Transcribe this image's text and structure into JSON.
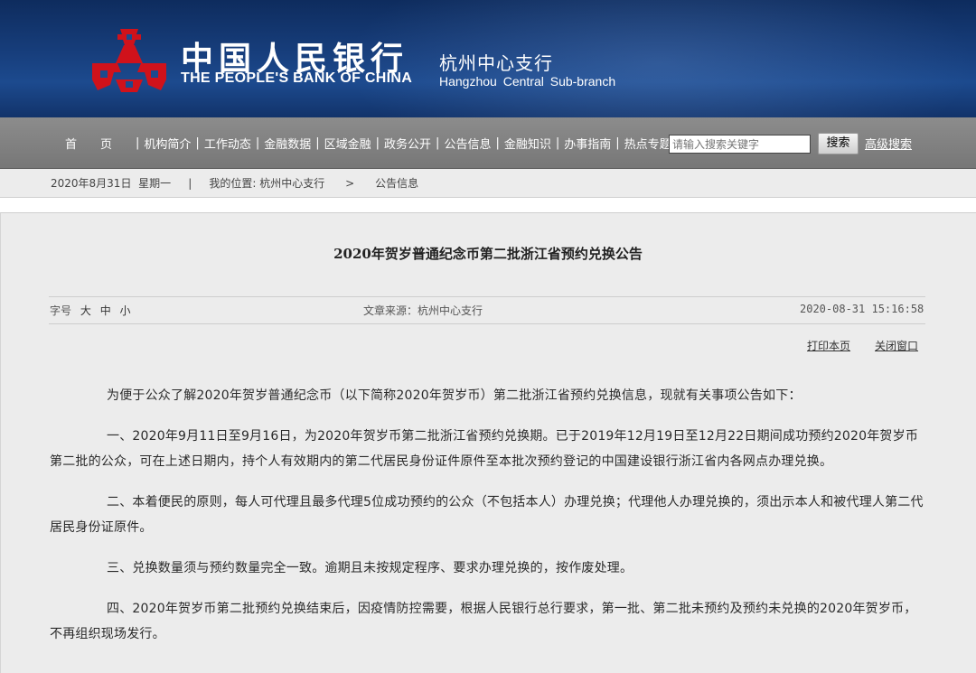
{
  "header": {
    "bank_name_cn": "中国人民银行",
    "bank_name_en": "THE PEOPLE'S BANK OF CHINA",
    "branch_cn": "杭州中心支行",
    "branch_en": "Hangzhou Central Sub-branch",
    "logo_icon": "pboc-emblem-icon",
    "colors": {
      "banner": "#173e7c",
      "emblem": "#d0121b"
    }
  },
  "nav": {
    "items": [
      "首页",
      "机构简介",
      "工作动态",
      "金融数据",
      "区域金融",
      "政务公开",
      "公告信息",
      "金融知识",
      "办事指南",
      "热点专题"
    ],
    "separator": "|",
    "search_placeholder": "请输入搜索关键字",
    "search_button": "搜索",
    "advanced_search": "高级搜索"
  },
  "breadcrumb": {
    "date": "2020年8月31日  星期一",
    "sep": "|",
    "location_label": "我的位置:",
    "level1": "杭州中心支行",
    "arrow": ">",
    "level2": "公告信息"
  },
  "article": {
    "title": "2020年贺岁普通纪念币第二批浙江省预约兑换公告",
    "font_label": "字号",
    "font_sizes": [
      "大",
      "中",
      "小"
    ],
    "source": "文章来源：杭州中心支行",
    "datetime": "2020-08-31 15:16:58",
    "print_label": "打印本页",
    "close_label": "关闭窗口",
    "paragraphs": [
      "为便于公众了解2020年贺岁普通纪念币（以下简称2020年贺岁币）第二批浙江省预约兑换信息，现就有关事项公告如下：",
      "一、2020年9月11日至9月16日，为2020年贺岁币第二批浙江省预约兑换期。已于2019年12月19日至12月22日期间成功预约2020年贺岁币第二批的公众，可在上述日期内，持个人有效期内的第二代居民身份证件原件至本批次预约登记的中国建设银行浙江省内各网点办理兑换。",
      "二、本着便民的原则，每人可代理且最多代理5位成功预约的公众（不包括本人）办理兑换；代理他人办理兑换的，须出示本人和被代理人第二代居民身份证原件。",
      "三、兑换数量须与预约数量完全一致。逾期且未按规定程序、要求办理兑换的，按作废处理。",
      "四、2020年贺岁币第二批预约兑换结束后，因疫情防控需要，根据人民银行总行要求，第一批、第二批未预约及预约未兑换的2020年贺岁币，不再组织现场发行。"
    ]
  }
}
